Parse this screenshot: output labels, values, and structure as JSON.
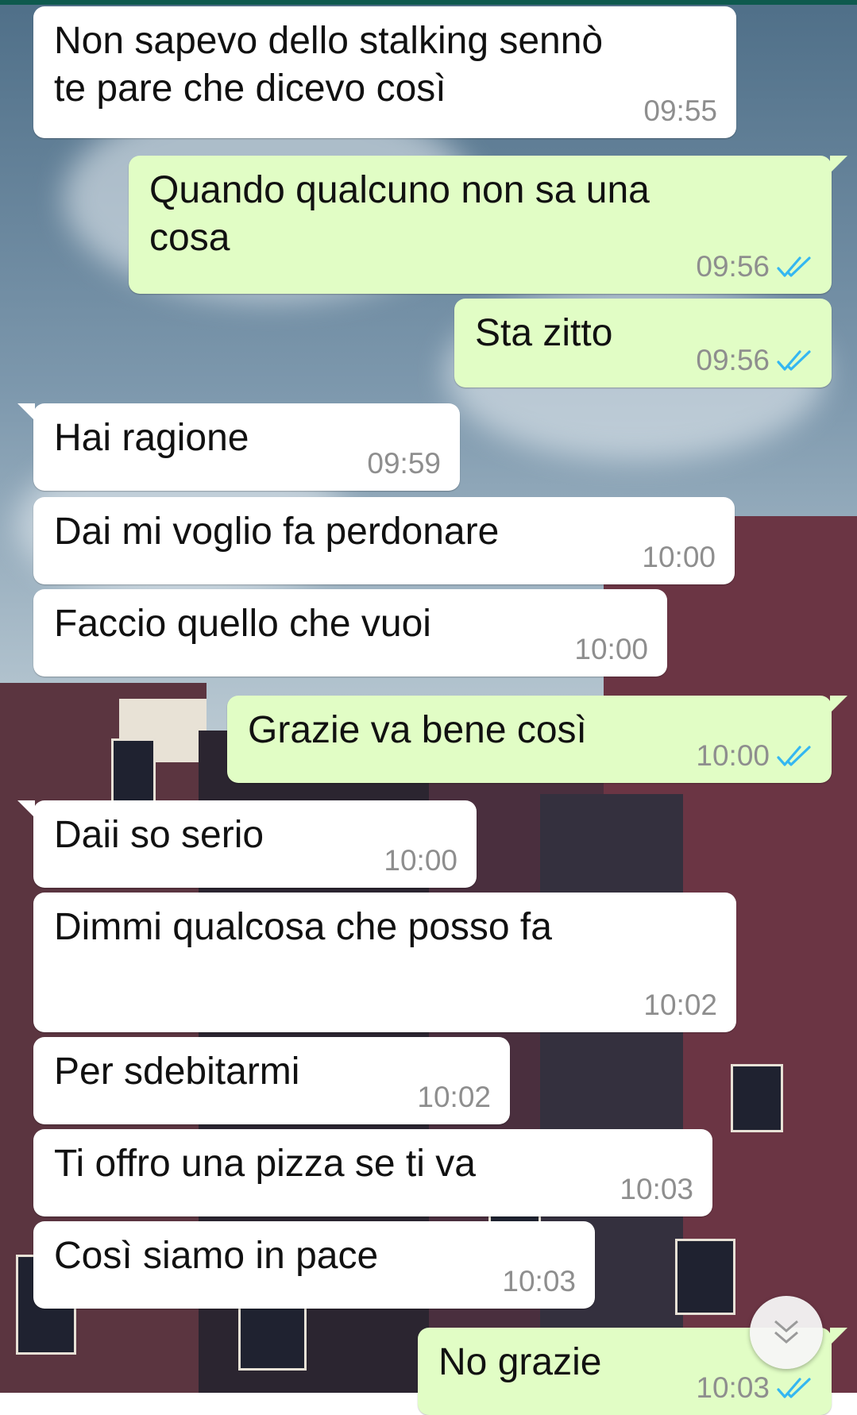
{
  "chat": {
    "messages": [
      {
        "direction": "incoming",
        "text_lines": [
          "Non sapevo dello stalking sennò",
          "te pare che dicevo così"
        ],
        "time": "09:55"
      },
      {
        "direction": "outgoing",
        "text_lines": [
          "Quando qualcuno non sa una",
          "cosa"
        ],
        "time": "09:56",
        "status": "read"
      },
      {
        "direction": "outgoing",
        "text_lines": [
          "Sta zitto"
        ],
        "time": "09:56",
        "status": "read"
      },
      {
        "direction": "incoming",
        "text_lines": [
          "Hai ragione"
        ],
        "time": "09:59"
      },
      {
        "direction": "incoming",
        "text_lines": [
          "Dai mi voglio fa perdonare"
        ],
        "time": "10:00"
      },
      {
        "direction": "incoming",
        "text_lines": [
          "Faccio quello che vuoi"
        ],
        "time": "10:00"
      },
      {
        "direction": "outgoing",
        "text_lines": [
          "Grazie va bene così"
        ],
        "time": "10:00",
        "status": "read"
      },
      {
        "direction": "incoming",
        "text_lines": [
          "Daii so serio"
        ],
        "time": "10:00"
      },
      {
        "direction": "incoming",
        "text_lines": [
          "Dimmi qualcosa che posso fa"
        ],
        "time": "10:02"
      },
      {
        "direction": "incoming",
        "text_lines": [
          "Per sdebitarmi"
        ],
        "time": "10:02"
      },
      {
        "direction": "incoming",
        "text_lines": [
          "Ti offro una pizza se ti va"
        ],
        "time": "10:03"
      },
      {
        "direction": "incoming",
        "text_lines": [
          "Così siamo in pace"
        ],
        "time": "10:03"
      },
      {
        "direction": "outgoing",
        "text_lines": [
          "No grazie"
        ],
        "time": "10:03",
        "status": "read"
      }
    ]
  },
  "icons": {
    "read_receipt": "double-check-icon",
    "scroll_down": "chevron-double-down-icon"
  },
  "colors": {
    "incoming_bubble": "#ffffff",
    "outgoing_bubble": "#e1fdc5",
    "read_tick": "#34b7f1",
    "timestamp": "#8e8e8e"
  }
}
